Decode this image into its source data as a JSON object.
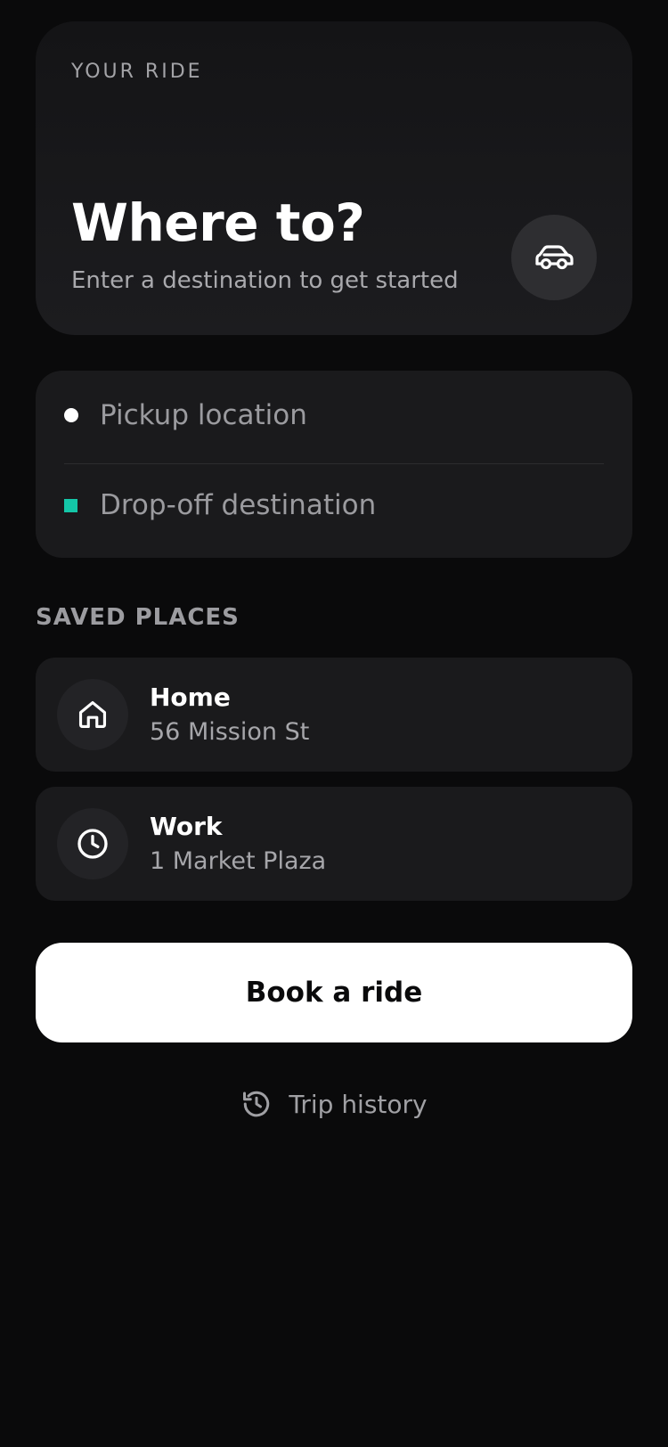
{
  "hero": {
    "eyebrow": "YOUR RIDE",
    "title": "Where to?",
    "subtitle": "Enter a destination to get started",
    "icon": "car-icon"
  },
  "route": {
    "pickup_placeholder": "Pickup location",
    "dropoff_placeholder": "Drop-off destination",
    "pickup_marker_color": "#ffffff",
    "dropoff_marker_color": "#14c7a8"
  },
  "saved_places": {
    "label": "SAVED PLACES",
    "items": [
      {
        "name": "Home",
        "address": "56 Mission St",
        "icon": "home-icon"
      },
      {
        "name": "Work",
        "address": "1 Market Plaza",
        "icon": "clock-icon"
      }
    ]
  },
  "actions": {
    "book_label": "Book a ride",
    "history_label": "Trip history",
    "history_icon": "history-icon"
  },
  "colors": {
    "background": "#0a0a0b",
    "card": "#1a1a1c",
    "accent": "#14c7a8",
    "primary_button": "#ffffff"
  }
}
